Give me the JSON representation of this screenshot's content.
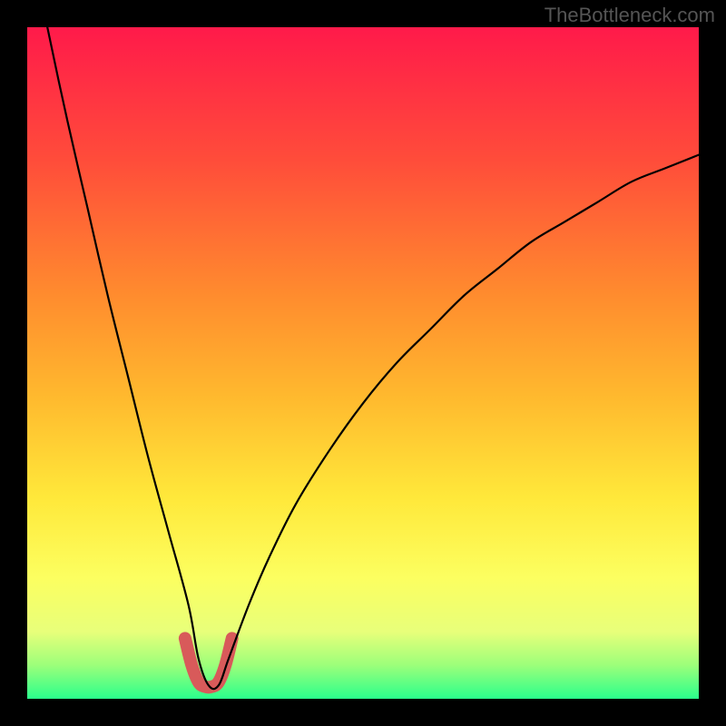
{
  "watermark": "TheBottleneck.com",
  "chart_data": {
    "type": "line",
    "title": "",
    "xlabel": "",
    "ylabel": "",
    "xlim": [
      0,
      100
    ],
    "ylim": [
      0,
      100
    ],
    "series": [
      {
        "name": "bottleneck-curve",
        "x": [
          0,
          3,
          6,
          9,
          12,
          15,
          18,
          21,
          24,
          25.5,
          27,
          28.5,
          30,
          33,
          36,
          40,
          45,
          50,
          55,
          60,
          65,
          70,
          75,
          80,
          85,
          90,
          95,
          100
        ],
        "values": [
          115,
          100,
          86,
          73,
          60,
          48,
          36,
          25,
          14,
          6,
          2,
          2,
          6,
          14,
          21,
          29,
          37,
          44,
          50,
          55,
          60,
          64,
          68,
          71,
          74,
          77,
          79,
          81
        ]
      },
      {
        "name": "minimum-highlight",
        "x": [
          23.5,
          24.5,
          25.5,
          26.5,
          27.5,
          28.5,
          29.5,
          30.5
        ],
        "values": [
          9,
          5,
          2.5,
          1.8,
          1.8,
          2.5,
          5,
          9
        ]
      }
    ],
    "background_gradient": {
      "stops": [
        {
          "pos": 0.0,
          "color": "#ff1a4a"
        },
        {
          "pos": 0.2,
          "color": "#ff4d3a"
        },
        {
          "pos": 0.4,
          "color": "#ff8c2e"
        },
        {
          "pos": 0.55,
          "color": "#ffb92e"
        },
        {
          "pos": 0.7,
          "color": "#ffe83a"
        },
        {
          "pos": 0.82,
          "color": "#fcff60"
        },
        {
          "pos": 0.9,
          "color": "#e8ff7a"
        },
        {
          "pos": 0.95,
          "color": "#9cff7a"
        },
        {
          "pos": 1.0,
          "color": "#2aff8c"
        }
      ]
    },
    "colors": {
      "curve": "#000000",
      "highlight": "#d85a5a",
      "frame": "#000000"
    }
  }
}
